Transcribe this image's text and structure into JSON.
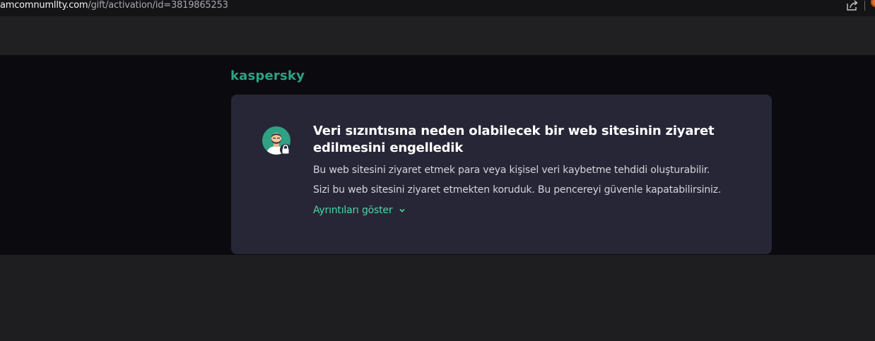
{
  "browser": {
    "url_host": "amcomnumllty.com",
    "url_path": "/gift/activation/id=3819865253",
    "share_icon": "share-icon",
    "extension_icon": "extension-icon"
  },
  "brand": {
    "name": "kaspersky",
    "color": "#2fa184"
  },
  "alert": {
    "icon": "user-lock-icon",
    "title": "Veri sızıntısına neden olabilecek bir web sitesinin ziyaret edilmesini engelledik",
    "message_1": "Bu web sitesini ziyaret etmek para veya kişisel veri kaybetme tehdidi oluşturabilir.",
    "message_2": "Sizi bu web sitesini ziyaret etmekten koruduk. Bu pencereyi güvenle kapatabilirsiniz.",
    "details_label": "Ayrıntıları göster",
    "details_icon": "chevron-down-icon",
    "accent_color": "#4fd5a6",
    "card_color": "#272636"
  }
}
